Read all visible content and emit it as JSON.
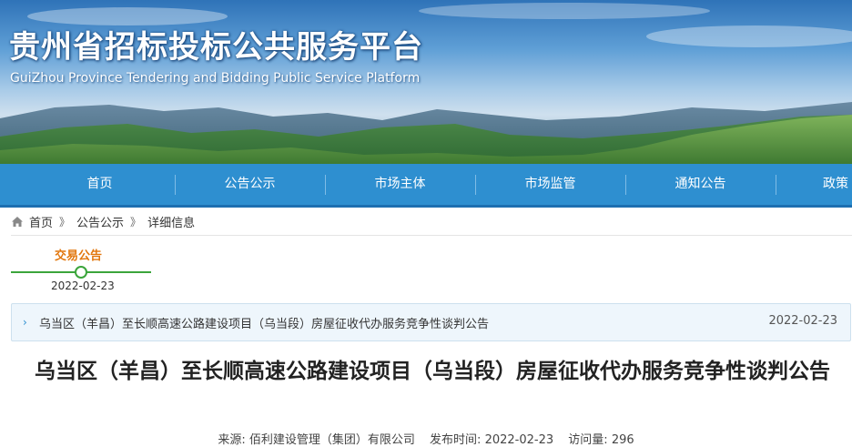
{
  "site": {
    "title": "贵州省招标投标公共服务平台",
    "subtitle": "GuiZhou Province Tendering and Bidding Public Service Platform"
  },
  "nav": {
    "items": [
      "首页",
      "公告公示",
      "市场主体",
      "市场监管",
      "通知公告",
      "政策"
    ]
  },
  "breadcrumb": {
    "items": [
      "首页",
      "公告公示",
      "详细信息"
    ],
    "separator": "》"
  },
  "timeline": {
    "label": "交易公告",
    "date": "2022-02-23"
  },
  "notice": {
    "text": "乌当区（羊昌）至长顺高速公路建设项目（乌当段）房屋征收代办服务竞争性谈判公告",
    "date": "2022-02-23"
  },
  "article": {
    "title": "乌当区（羊昌）至长顺高速公路建设项目（乌当段）房屋征收代办服务竞争性谈判公告",
    "source_label": "来源:",
    "source": "佰利建设管理（集团）有限公司",
    "publish_label": "发布时间:",
    "publish_time": "2022-02-23",
    "views_label": "访问量:",
    "views": "296"
  },
  "colors": {
    "nav_bg": "#2e8fd0",
    "timeline_label": "#e2770e",
    "timeline_line": "#3ba53b"
  }
}
